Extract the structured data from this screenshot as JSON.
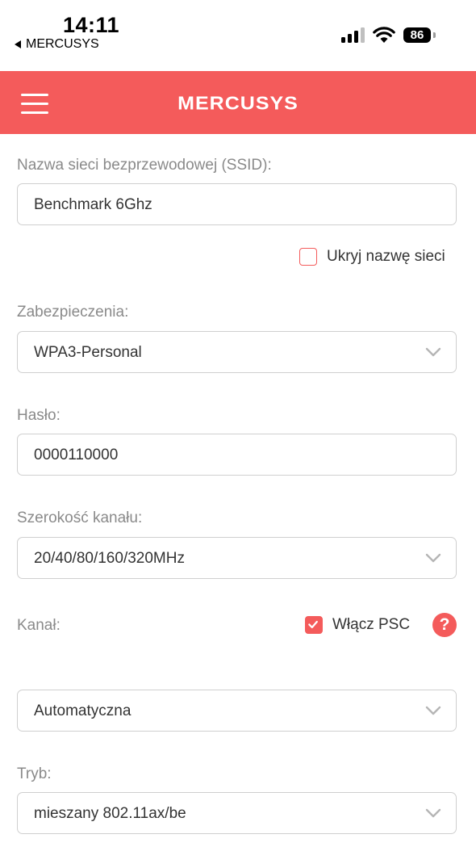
{
  "status_bar": {
    "time": "14:11",
    "back_label": "MERCUSYS",
    "battery": "86"
  },
  "header": {
    "logo_text": "MERCUSYS",
    "menu_icon": "hamburger-menu-icon",
    "accent_color": "#f45b5b"
  },
  "form": {
    "ssid": {
      "label": "Nazwa sieci bezprzewodowej (SSID):",
      "value": "Benchmark 6Ghz"
    },
    "hide_ssid": {
      "label": "Ukryj nazwę sieci",
      "checked": false
    },
    "security": {
      "label": "Zabezpieczenia:",
      "value": "WPA3-Personal"
    },
    "password": {
      "label": "Hasło:",
      "value": "0000110000"
    },
    "channel_width": {
      "label": "Szerokość kanału:",
      "value": "20/40/80/160/320MHz"
    },
    "channel": {
      "label": "Kanał:",
      "value": "Automatyczna"
    },
    "psc": {
      "label": "Włącz PSC",
      "checked": true,
      "help_icon": "question-mark-icon"
    },
    "mode": {
      "label": "Tryb:",
      "value": "mieszany 802.11ax/be"
    }
  }
}
